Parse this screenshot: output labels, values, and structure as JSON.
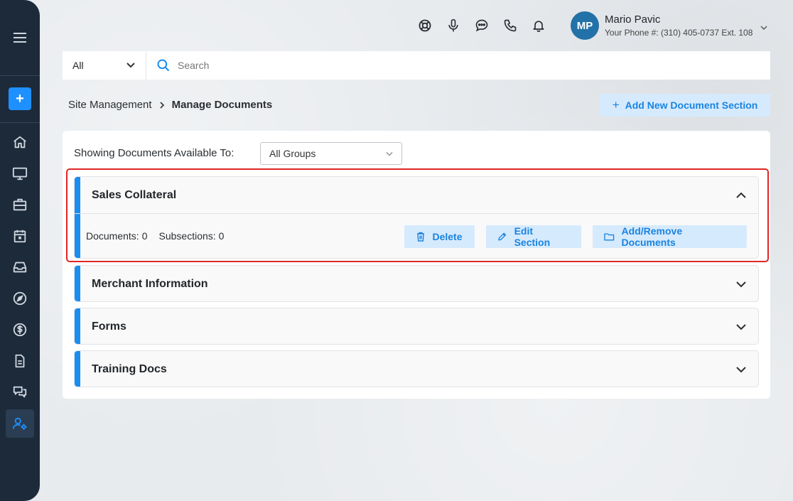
{
  "sidebar": {
    "menu_icon": "hamburger-icon",
    "add_label": "+",
    "items": [
      {
        "name": "home",
        "icon": "home-icon"
      },
      {
        "name": "monitor",
        "icon": "monitor-icon"
      },
      {
        "name": "briefcase",
        "icon": "briefcase-icon"
      },
      {
        "name": "calendar",
        "icon": "calendar-icon"
      },
      {
        "name": "inbox",
        "icon": "inbox-icon"
      },
      {
        "name": "compass",
        "icon": "compass-icon"
      },
      {
        "name": "billing",
        "icon": "dollar-icon"
      },
      {
        "name": "documents",
        "icon": "document-icon"
      },
      {
        "name": "messages",
        "icon": "chat-icon"
      },
      {
        "name": "user-settings",
        "icon": "user-gear-icon",
        "active": true
      }
    ]
  },
  "header": {
    "icons": [
      "support-icon",
      "microphone-icon",
      "chat-bubble-icon",
      "phone-icon",
      "bell-icon"
    ],
    "user": {
      "initials": "MP",
      "name": "Mario Pavic",
      "phone": "Your Phone #: (310) 405-0737 Ext. 108"
    }
  },
  "search": {
    "scope": "All",
    "placeholder": "Search",
    "value": ""
  },
  "breadcrumb": {
    "parent": "Site Management",
    "current": "Manage Documents"
  },
  "add_section_label": "Add New Document Section",
  "filter": {
    "label": "Showing Documents Available To:",
    "selected": "All Groups"
  },
  "sections": [
    {
      "title": "Sales Collateral",
      "expanded": true,
      "documents_label": "Documents:",
      "documents_count": "0",
      "subsections_label": "Subsections:",
      "subsections_count": "0",
      "actions": {
        "delete": "Delete",
        "edit": "Edit Section",
        "add_remove": "Add/Remove Documents"
      }
    },
    {
      "title": "Merchant Information",
      "expanded": false
    },
    {
      "title": "Forms",
      "expanded": false
    },
    {
      "title": "Training Docs",
      "expanded": false
    }
  ],
  "colors": {
    "sidebar_bg": "#1c2a3a",
    "accent": "#1a8ef0",
    "button_bg": "#d6eafd",
    "highlight": "#e02626",
    "avatar_bg": "#2271a8"
  }
}
